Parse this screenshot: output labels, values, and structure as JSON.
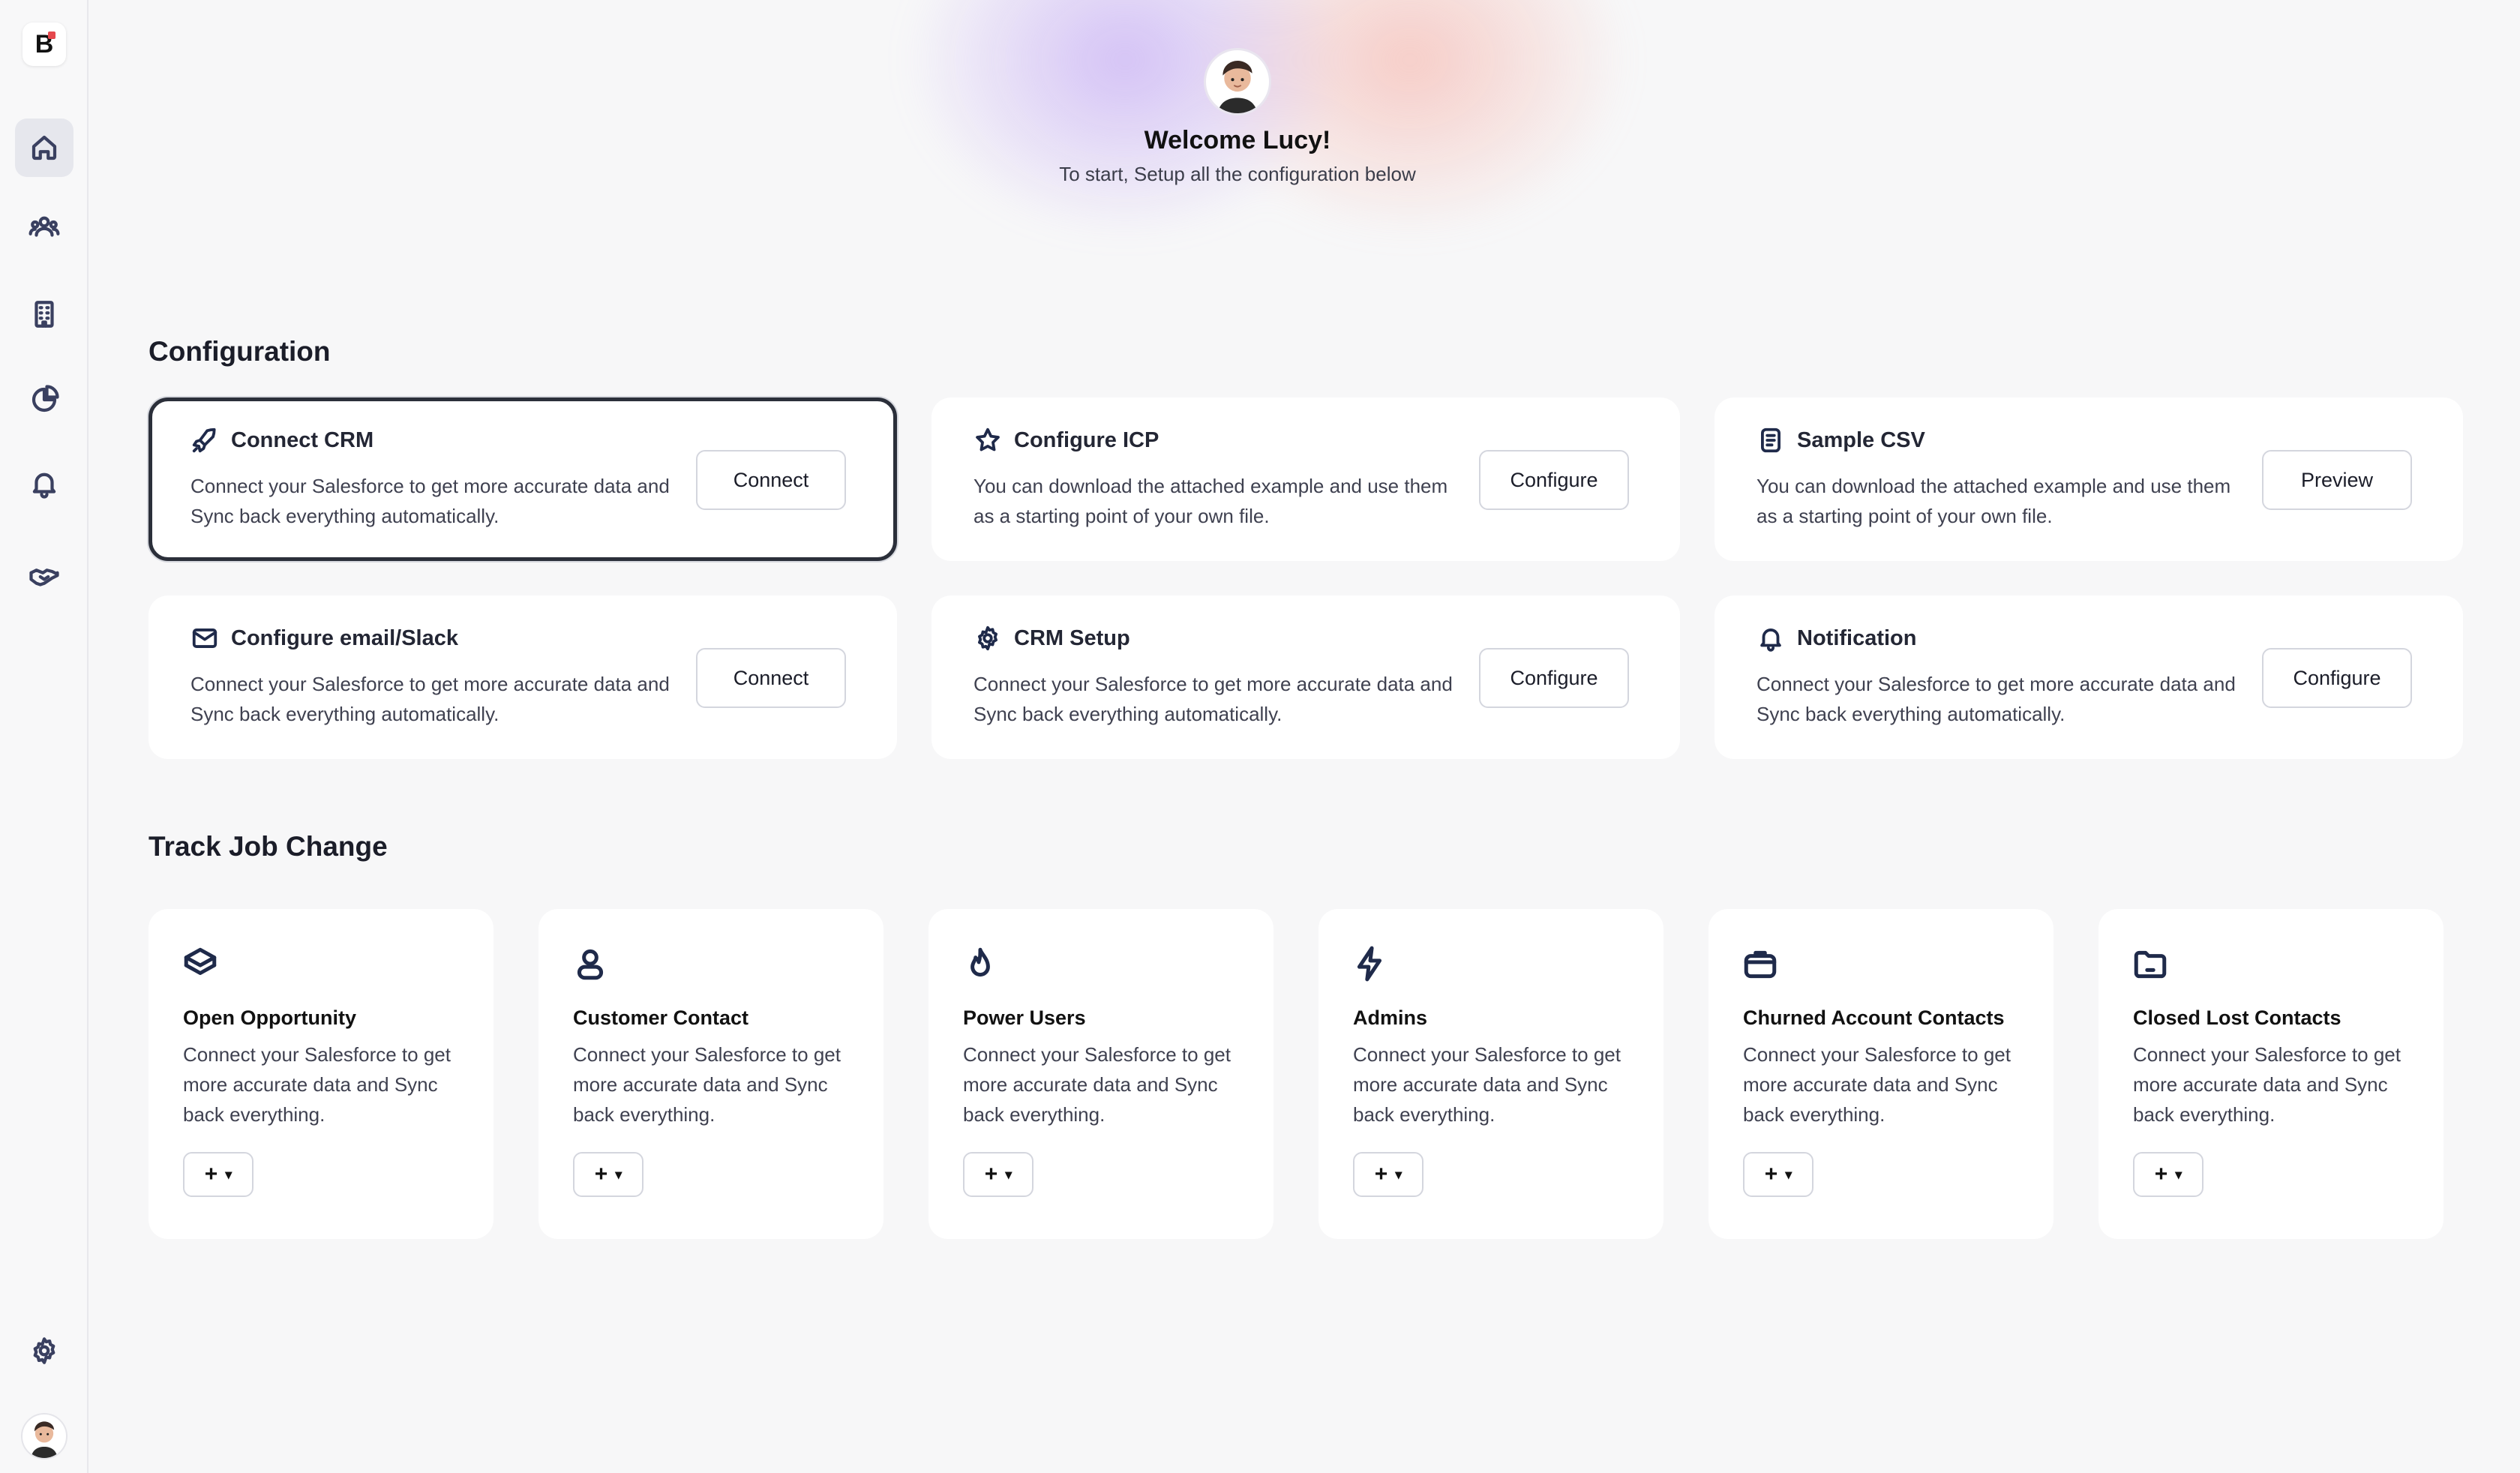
{
  "app": {
    "logo_letter": "B"
  },
  "welcome": {
    "title": "Welcome Lucy!",
    "subtitle": "To start, Setup all the configuration below"
  },
  "sidebar": {
    "items": [
      {
        "icon": "home-icon",
        "active": true
      },
      {
        "icon": "users-icon",
        "active": false
      },
      {
        "icon": "building-icon",
        "active": false
      },
      {
        "icon": "pie-chart-icon",
        "active": false
      },
      {
        "icon": "bell-icon",
        "active": false
      },
      {
        "icon": "handshake-icon",
        "active": false
      }
    ],
    "settings_icon": "gear-icon"
  },
  "configuration": {
    "title": "Configuration",
    "cards": [
      {
        "title": "Connect CRM",
        "desc": "Connect your Salesforce to get more accurate data and Sync back everything automatically.",
        "button": "Connect",
        "icon": "rocket-icon"
      },
      {
        "title": "Configure ICP",
        "desc": "You can download the attached example and use them as a starting point of your own file.",
        "button": "Configure",
        "icon": "star-icon"
      },
      {
        "title": "Sample CSV",
        "desc": "You can download the attached example and use them as a starting point of your own file.",
        "button": "Preview",
        "icon": "file-icon"
      },
      {
        "title": "Configure email/Slack",
        "desc": "Connect your Salesforce to get more accurate data and Sync back everything automatically.",
        "button": "Connect",
        "icon": "mail-icon"
      },
      {
        "title": "CRM Setup",
        "desc": "Connect your Salesforce to get more accurate data and Sync back everything automatically.",
        "button": "Configure",
        "icon": "gear-icon"
      },
      {
        "title": "Notification",
        "desc": "Connect your Salesforce to get more accurate data and Sync back everything automatically.",
        "button": "Configure",
        "icon": "bell-icon"
      }
    ]
  },
  "track": {
    "title": "Track Job Change",
    "cards": [
      {
        "title": "Open Opportunity",
        "desc": "Connect your Salesforce to get more accurate data and Sync back everything.",
        "icon": "layers-icon",
        "button": "+"
      },
      {
        "title": "Customer Contact",
        "desc": "Connect your Salesforce to get more accurate data and Sync back everything.",
        "icon": "user-icon",
        "button": "+"
      },
      {
        "title": "Power Users",
        "desc": "Connect your Salesforce to get more accurate data and Sync back everything.",
        "icon": "flame-icon",
        "button": "+"
      },
      {
        "title": "Admins",
        "desc": "Connect your Salesforce to get more accurate data and Sync back everything.",
        "icon": "lightning-icon",
        "button": "+"
      },
      {
        "title": "Churned Account Contacts",
        "desc": "Connect your Salesforce to get more accurate data and Sync back everything.",
        "icon": "briefcase-icon",
        "button": "+"
      },
      {
        "title": "Closed Lost Contacts",
        "desc": "Connect your Salesforce to get more accurate data and Sync back everything.",
        "icon": "folder-icon",
        "button": "+"
      }
    ]
  }
}
